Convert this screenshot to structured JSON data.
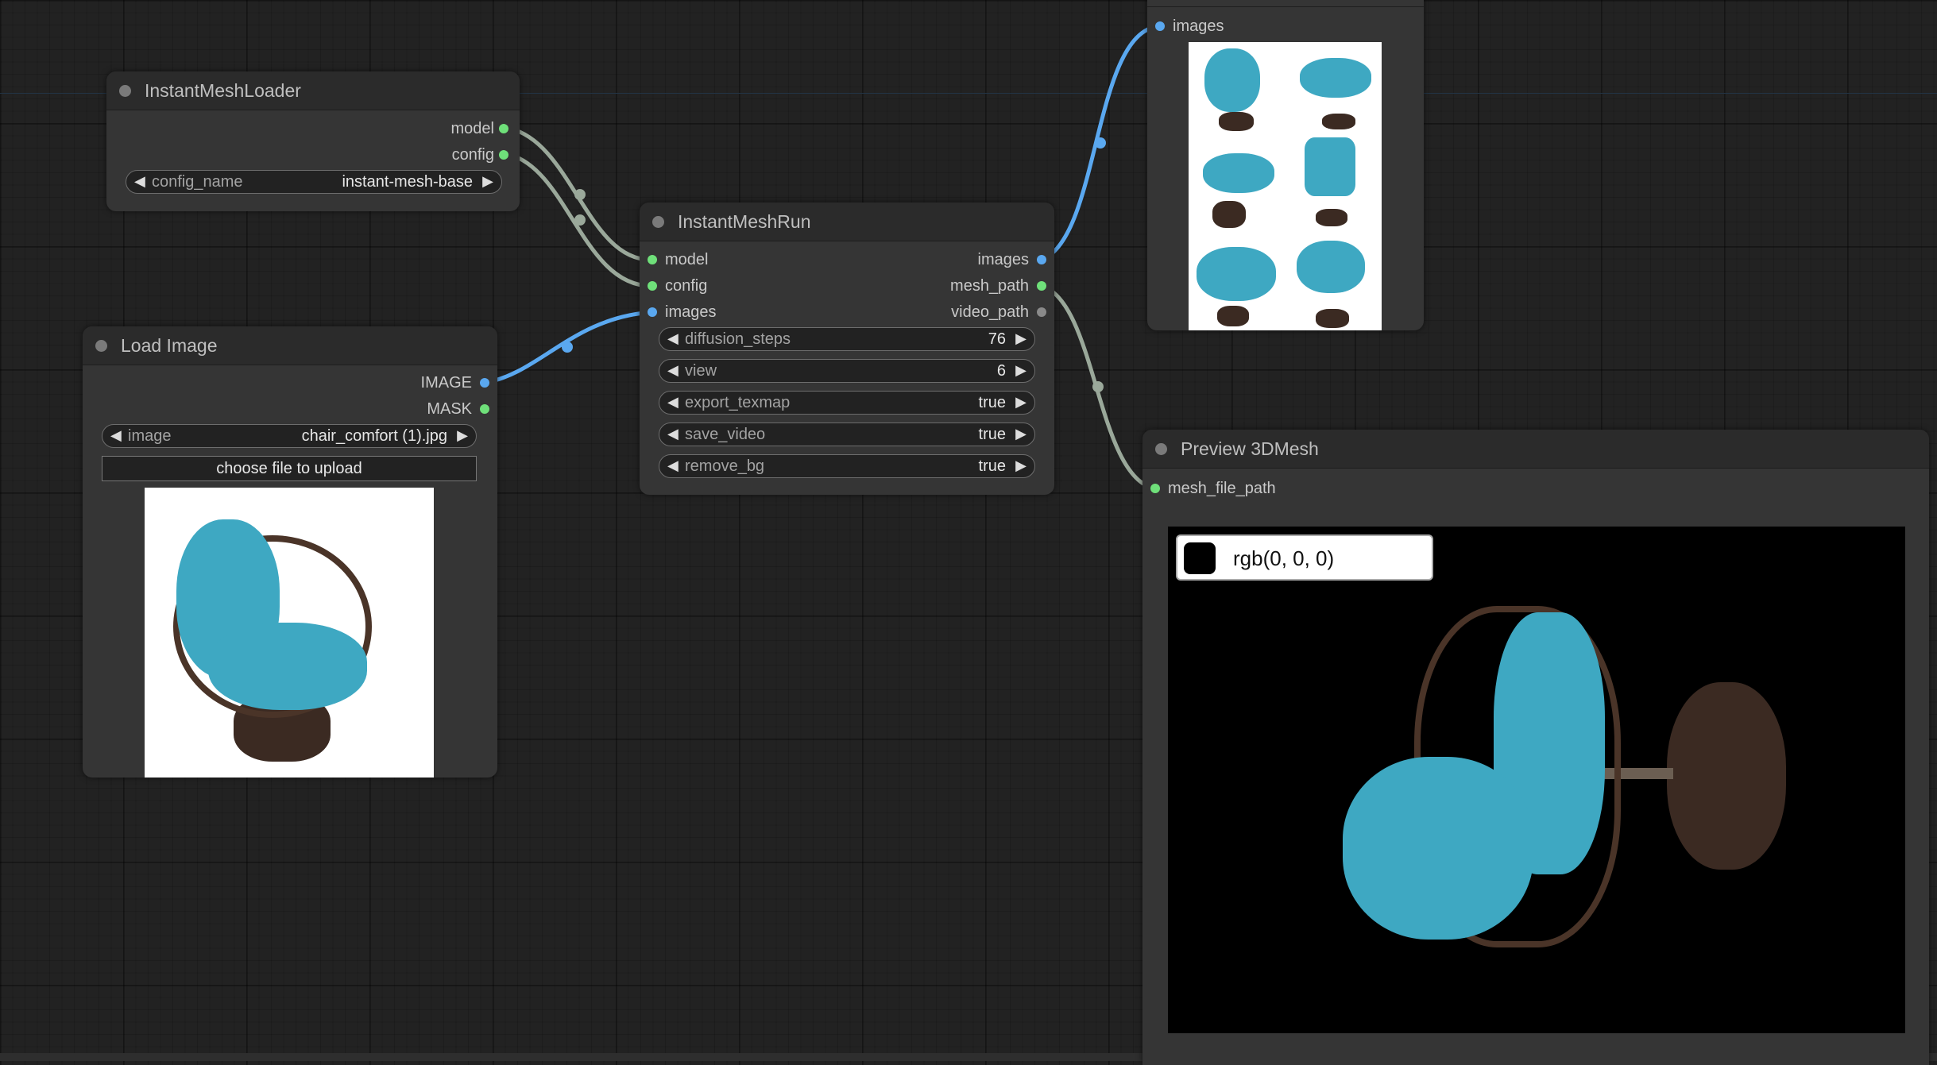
{
  "nodes": {
    "loader": {
      "title": "InstantMeshLoader",
      "outputs": [
        "model",
        "config"
      ],
      "widget": {
        "label": "config_name",
        "value": "instant-mesh-base"
      }
    },
    "load_image": {
      "title": "Load Image",
      "outputs": [
        "IMAGE",
        "MASK"
      ],
      "widget": {
        "label": "image",
        "value": "chair_comfort (1).jpg"
      },
      "upload_label": "choose file to upload"
    },
    "run": {
      "title": "InstantMeshRun",
      "inputs": [
        "model",
        "config",
        "images"
      ],
      "outputs": [
        "images",
        "mesh_path",
        "video_path"
      ],
      "widgets": [
        {
          "label": "diffusion_steps",
          "value": "76"
        },
        {
          "label": "view",
          "value": "6"
        },
        {
          "label": "export_texmap",
          "value": "true"
        },
        {
          "label": "save_video",
          "value": "true"
        },
        {
          "label": "remove_bg",
          "value": "true"
        }
      ]
    },
    "preview_image": {
      "inputs": [
        "images"
      ]
    },
    "preview_mesh": {
      "title": "Preview 3DMesh",
      "inputs": [
        "mesh_file_path"
      ],
      "bg_color_text": "rgb(0, 0, 0)"
    }
  },
  "colors": {
    "canvas_bg": "#222222",
    "node_bg": "#353535",
    "title_bg": "#2b2b2b",
    "model_link": "#9aa89a",
    "image_link": "#5aa8f0",
    "slot_green": "#6fe07a",
    "slot_blue": "#5aa8f0",
    "slot_grey": "#8a8a8a",
    "cushion": "#3ea8c2"
  },
  "icons": {
    "widget_left": "triangle-left-icon",
    "widget_right": "triangle-right-icon",
    "node_status": "circle-dot-icon"
  }
}
